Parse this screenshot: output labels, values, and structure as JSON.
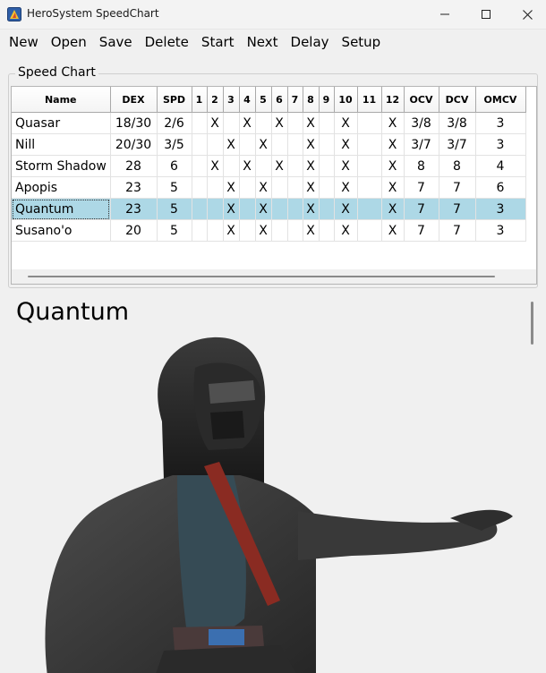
{
  "window": {
    "title": "HeroSystem SpeedChart"
  },
  "menu": [
    "New",
    "Open",
    "Save",
    "Delete",
    "Start",
    "Next",
    "Delay",
    "Setup"
  ],
  "group": {
    "label": "Speed Chart"
  },
  "table": {
    "columns": [
      "Name",
      "DEX",
      "SPD",
      "1",
      "2",
      "3",
      "4",
      "5",
      "6",
      "7",
      "8",
      "9",
      "10",
      "11",
      "12",
      "OCV",
      "DCV",
      "OMCV"
    ],
    "rows": [
      [
        "Quasar",
        "18/30",
        "2/6",
        "",
        "X",
        "",
        "X",
        "",
        "X",
        "",
        "X",
        "",
        "X",
        "",
        "X",
        "3/8",
        "3/8",
        "3"
      ],
      [
        "Nill",
        "20/30",
        "3/5",
        "",
        "",
        "X",
        "",
        "X",
        "",
        "",
        "X",
        "",
        "X",
        "",
        "X",
        "3/7",
        "3/7",
        "3"
      ],
      [
        "Storm Shadow",
        "28",
        "6",
        "",
        "X",
        "",
        "X",
        "",
        "X",
        "",
        "X",
        "",
        "X",
        "",
        "X",
        "8",
        "8",
        "4"
      ],
      [
        "Apopis",
        "23",
        "5",
        "",
        "",
        "X",
        "",
        "X",
        "",
        "",
        "X",
        "",
        "X",
        "",
        "X",
        "7",
        "7",
        "6"
      ],
      [
        "Quantum",
        "23",
        "5",
        "",
        "",
        "X",
        "",
        "X",
        "",
        "",
        "X",
        "",
        "X",
        "",
        "X",
        "7",
        "7",
        "3"
      ],
      [
        "Susano'o",
        "20",
        "5",
        "",
        "",
        "X",
        "",
        "X",
        "",
        "",
        "X",
        "",
        "X",
        "",
        "X",
        "7",
        "7",
        "3"
      ]
    ],
    "selected_row": 4
  },
  "detail": {
    "name": "Quantum"
  },
  "colors": {
    "selection": "#add8e6",
    "background": "#f0f0f0"
  }
}
